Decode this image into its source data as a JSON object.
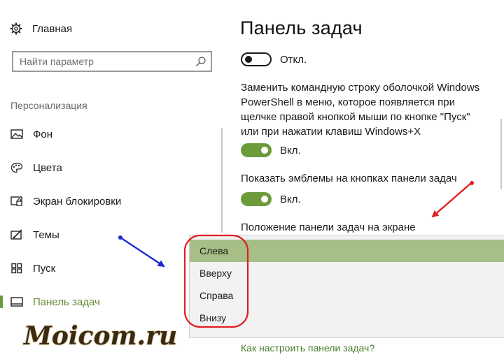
{
  "sidebar": {
    "home_label": "Главная",
    "search_placeholder": "Найти параметр",
    "section_label": "Персонализация",
    "items": [
      {
        "label": "Фон",
        "icon": "picture-icon"
      },
      {
        "label": "Цвета",
        "icon": "palette-icon"
      },
      {
        "label": "Экран блокировки",
        "icon": "lock-screen-icon"
      },
      {
        "label": "Темы",
        "icon": "themes-icon"
      },
      {
        "label": "Пуск",
        "icon": "start-icon"
      },
      {
        "label": "Панель задач",
        "icon": "taskbar-icon",
        "active": true
      }
    ]
  },
  "main": {
    "title": "Панель задач",
    "toggle_top": {
      "state": "off",
      "label": "Откл."
    },
    "powershell_text_lines": [
      "Заменить командную строку оболочкой Windows",
      "PowerShell в меню, которое появляется при",
      "щелчке правой кнопкой мыши по кнопке \"Пуск\"",
      "или при нажатии клавиш Windows+X"
    ],
    "toggle_powershell": {
      "state": "on",
      "label": "Вкл."
    },
    "badges_text": "Показать эмблемы на кнопках панели задач",
    "toggle_badges": {
      "state": "on",
      "label": "Вкл."
    },
    "position_label": "Положение панели задач на экране",
    "position_options": [
      "Слева",
      "Вверху",
      "Справа",
      "Внизу"
    ],
    "position_selected": "Слева",
    "help_link": "Как настроить панели задач?"
  },
  "watermark": "Moicom.ru",
  "colors": {
    "accent_green": "#6c9b3c",
    "selected_option": "#a6bf86",
    "annotation_red": "#e02020",
    "annotation_blue": "#1e2ad0"
  }
}
